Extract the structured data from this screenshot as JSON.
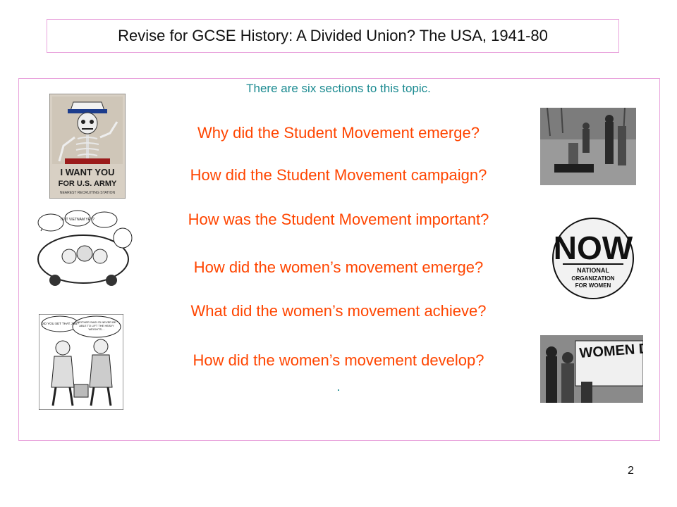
{
  "title": "Revise for GCSE History: A Divided Union? The USA, 1941-80",
  "intro": "There are six sections to this topic.",
  "sections": [
    "Why did the Student Movement emerge?",
    "How did the Student Movement campaign?",
    "How was the Student Movement important?",
    "How did the women’s movement emerge?",
    "What did the women’s movement achieve?",
    "How did the women’s movement develop?"
  ],
  "trailing_dot": ".",
  "page_number": "2",
  "images": {
    "poster": {
      "line1": "I WANT YOU",
      "line2": "FOR U.S. ARMY",
      "line3": "NEAREST RECRUITING STATION"
    },
    "cartoon_vietnam": {
      "bubble": "IS IT VIETNAM YET?"
    },
    "now_button": {
      "logo": "NOW",
      "line1": "NATIONAL",
      "line2": "ORGANIZATION",
      "line3": "FOR WOMEN"
    },
    "cartoon_women": {
      "bubble1": "DID YOU SET THAT JOB?",
      "bubble2": "NEITHER SAID I'D NEVER BE ABLE TO LIFT THE HEAVY WEIGHTS...."
    },
    "protest_photo": {
      "sign": "WOMEN DEMAND"
    }
  },
  "colors": {
    "border": "#e9a3dc",
    "intro": "#1a8a90",
    "questions": "#ff4500"
  }
}
